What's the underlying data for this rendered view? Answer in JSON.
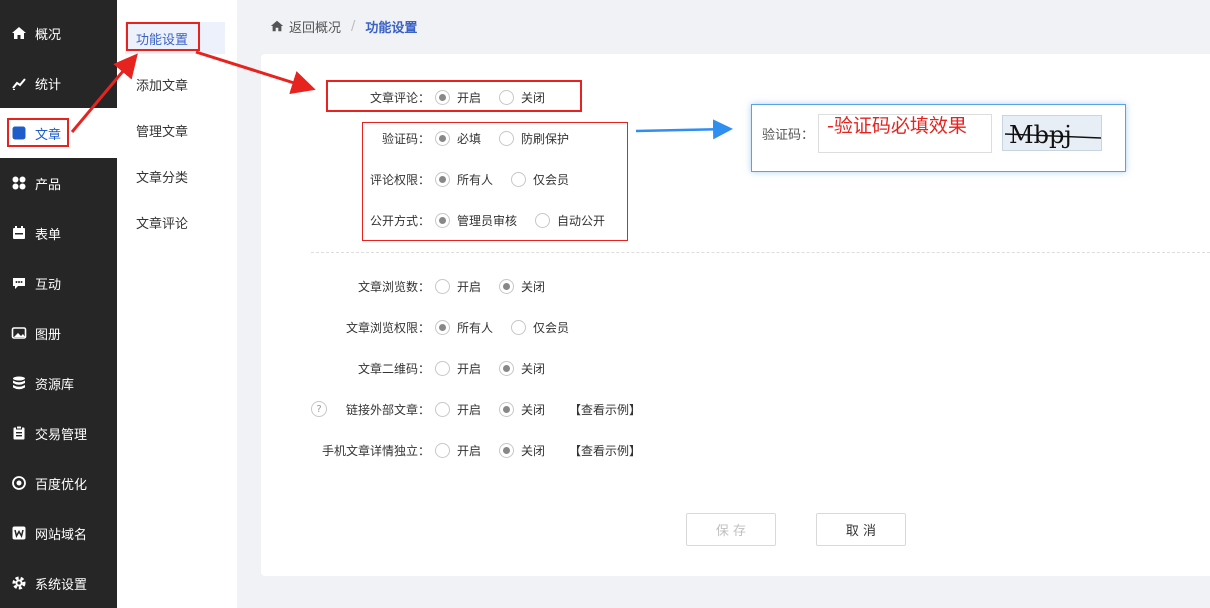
{
  "sidebar": {
    "items": [
      {
        "label": "概况",
        "icon": "home-icon"
      },
      {
        "label": "统计",
        "icon": "chart-icon"
      },
      {
        "label": "文章",
        "icon": "article-icon"
      },
      {
        "label": "产品",
        "icon": "grid-icon"
      },
      {
        "label": "表单",
        "icon": "calendar-icon"
      },
      {
        "label": "互动",
        "icon": "chat-icon"
      },
      {
        "label": "图册",
        "icon": "image-icon"
      },
      {
        "label": "资源库",
        "icon": "database-icon"
      },
      {
        "label": "交易管理",
        "icon": "clipboard-icon"
      },
      {
        "label": "百度优化",
        "icon": "target-icon"
      },
      {
        "label": "网站域名",
        "icon": "w-icon"
      },
      {
        "label": "系统设置",
        "icon": "gear-icon"
      }
    ]
  },
  "subnav": {
    "items": [
      "功能设置",
      "添加文章",
      "管理文章",
      "文章分类",
      "文章评论"
    ]
  },
  "breadcrumb": {
    "back": "返回概况",
    "separator": "/",
    "current": "功能设置"
  },
  "settings": {
    "comment": {
      "label": "文章评论：",
      "options": [
        "开启",
        "关闭"
      ],
      "selected": 0
    },
    "captcha": {
      "label": "验证码：",
      "options": [
        "必填",
        "防刷保护"
      ],
      "selected": 0
    },
    "comment_permission": {
      "label": "评论权限：",
      "options": [
        "所有人",
        "仅会员"
      ],
      "selected": 0
    },
    "publish_mode": {
      "label": "公开方式：",
      "options": [
        "管理员审核",
        "自动公开"
      ],
      "selected": 0
    },
    "view_count": {
      "label": "文章浏览数：",
      "options": [
        "开启",
        "关闭"
      ],
      "selected": 1
    },
    "view_permission": {
      "label": "文章浏览权限：",
      "options": [
        "所有人",
        "仅会员"
      ],
      "selected": 0
    },
    "qrcode": {
      "label": "文章二维码：",
      "options": [
        "开启",
        "关闭"
      ],
      "selected": 1
    },
    "external_link": {
      "label": "链接外部文章：",
      "options": [
        "开启",
        "关闭"
      ],
      "selected": 1,
      "help": "?",
      "example": "【查看示例】"
    },
    "mobile_detail": {
      "label": "手机文章详情独立：",
      "options": [
        "开启",
        "关闭"
      ],
      "selected": 1,
      "example": "【查看示例】"
    }
  },
  "buttons": {
    "save": "保 存",
    "cancel": "取 消"
  },
  "annotation": {
    "captcha_label": "验证码：",
    "captcha_note": "-验证码必填效果",
    "captcha_code": "Mbpj"
  },
  "colors": {
    "accent": "#3a62c6",
    "annotation_red": "#e6231f",
    "annotation_blue": "#2f8ff0",
    "sidebar_bg": "#262626"
  }
}
